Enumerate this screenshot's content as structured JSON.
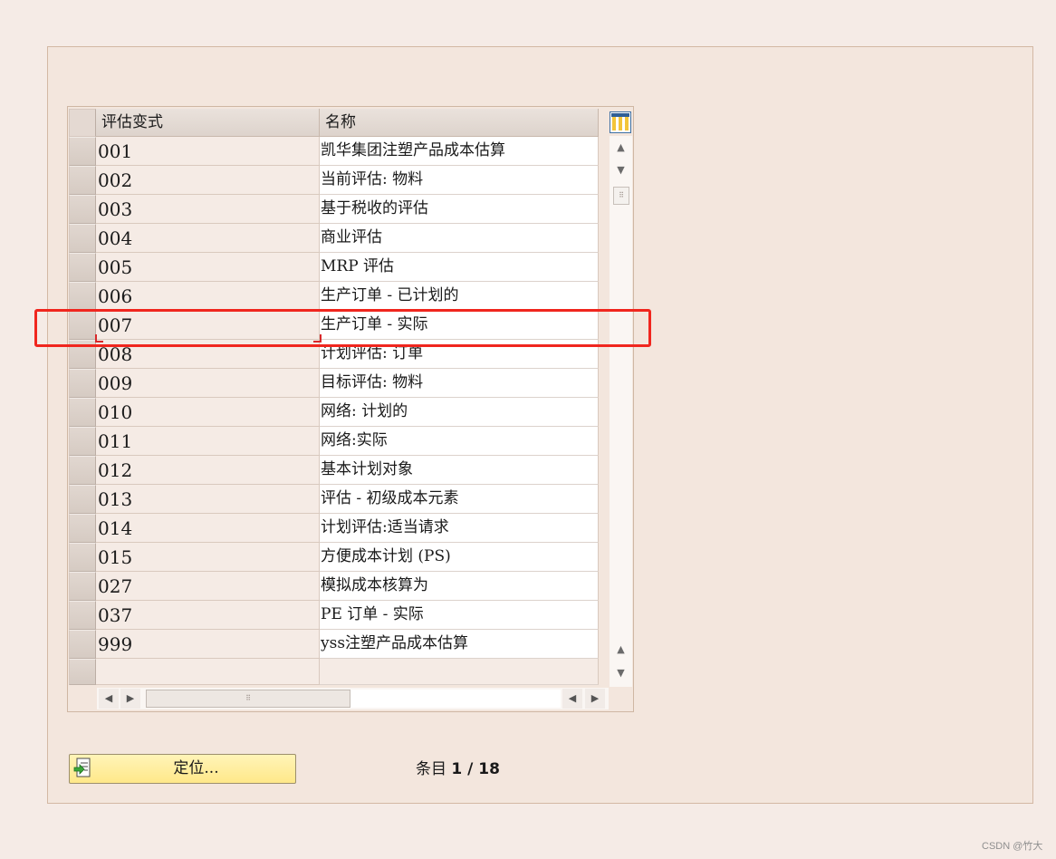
{
  "table": {
    "headers": [
      "评估变式",
      "名称"
    ],
    "rows": [
      {
        "code": "001",
        "name": "凯华集团注塑产品成本估算"
      },
      {
        "code": "002",
        "name": "当前评估: 物料"
      },
      {
        "code": "003",
        "name": "基于税收的评估"
      },
      {
        "code": "004",
        "name": "商业评估"
      },
      {
        "code": "005",
        "name": "MRP 评估"
      },
      {
        "code": "006",
        "name": "生产订单 - 已计划的"
      },
      {
        "code": "007",
        "name": "生产订单 - 实际"
      },
      {
        "code": "008",
        "name": "计划评估: 订单"
      },
      {
        "code": "009",
        "name": "目标评估: 物料"
      },
      {
        "code": "010",
        "name": "网络: 计划的"
      },
      {
        "code": "011",
        "name": "网络:实际"
      },
      {
        "code": "012",
        "name": "基本计划对象"
      },
      {
        "code": "013",
        "name": "评估 - 初级成本元素"
      },
      {
        "code": "014",
        "name": "计划评估:适当请求"
      },
      {
        "code": "015",
        "name": "方便成本计划 (PS)"
      },
      {
        "code": "027",
        "name": "模拟成本核算为"
      },
      {
        "code": "037",
        "name": "PE 订单 - 实际"
      },
      {
        "code": "999",
        "name": "yss注塑产品成本估算"
      }
    ],
    "highlighted_code": "007"
  },
  "footer": {
    "locate_button": "定位...",
    "entry_label": "条目",
    "entry_current": "1",
    "entry_separator": " / ",
    "entry_total": "18"
  },
  "watermark": "CSDN @竹大",
  "colors": {
    "highlight": "#f0261e",
    "button_yellow": "#ffe889",
    "panel_bg": "#f3e6dd"
  },
  "icons": {
    "column_config": "column-settings-icon",
    "locate": "locate-icon"
  }
}
